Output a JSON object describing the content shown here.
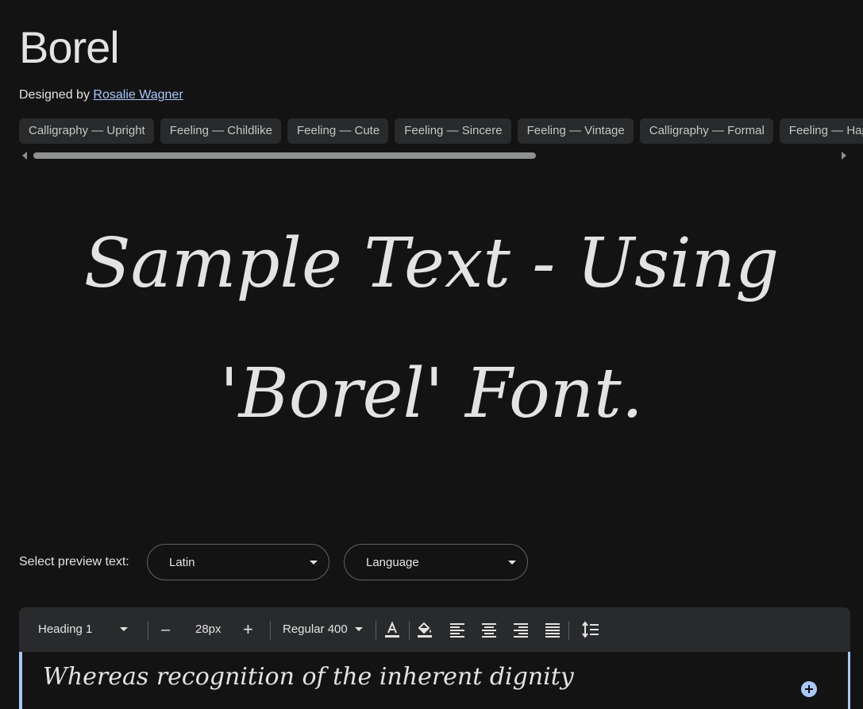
{
  "font": {
    "name": "Borel",
    "designed_by_label": "Designed by",
    "designer": "Rosalie Wagner"
  },
  "tags": [
    "Calligraphy — Upright",
    "Feeling — Childlike",
    "Feeling — Cute",
    "Feeling — Sincere",
    "Feeling — Vintage",
    "Calligraphy — Formal",
    "Feeling — Happy"
  ],
  "sample_text": "Sample Text - Using 'Borel' Font.",
  "preview": {
    "label": "Select preview text:",
    "script_value": "Latin",
    "language_value": "Language"
  },
  "toolbar": {
    "style_value": "Heading 1",
    "decrease_label": "–",
    "size_value": "28px",
    "increase_label": "+",
    "weight_value": "Regular 400"
  },
  "editor": {
    "text": "Whereas recognition of the inherent dignity"
  },
  "colors": {
    "background": "#131314",
    "accent": "#a8c7fa",
    "chip": "#282a2c"
  }
}
